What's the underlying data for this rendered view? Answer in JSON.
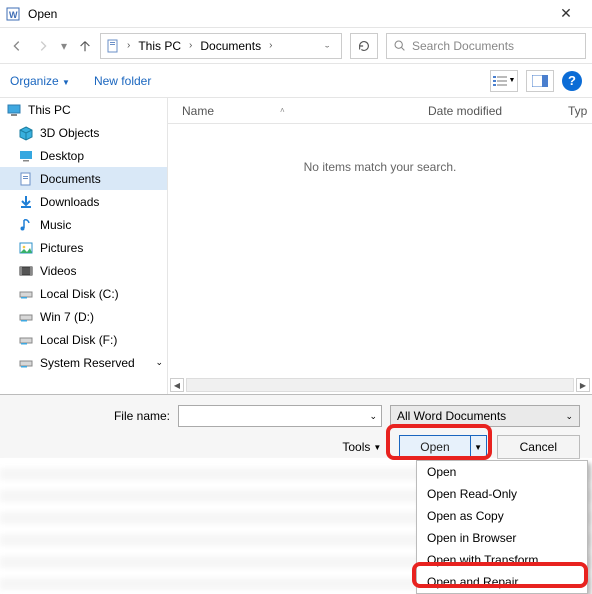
{
  "title": "Open",
  "breadcrumb": {
    "item1": "This PC",
    "item2": "Documents"
  },
  "search": {
    "placeholder": "Search Documents"
  },
  "toolbar": {
    "organize": "Organize",
    "newfolder": "New folder"
  },
  "sidebar": {
    "root": "This PC",
    "items": [
      "3D Objects",
      "Desktop",
      "Documents",
      "Downloads",
      "Music",
      "Pictures",
      "Videos",
      "Local Disk (C:)",
      "Win 7 (D:)",
      "Local Disk (F:)",
      "System Reserved"
    ]
  },
  "columns": {
    "name": "Name",
    "date": "Date modified",
    "type": "Typ"
  },
  "empty": "No items match your search.",
  "filename_label": "File name:",
  "filetype": "All Word Documents",
  "tools": "Tools",
  "open": "Open",
  "cancel": "Cancel",
  "menu": {
    "m1": "Open",
    "m2": "Open Read-Only",
    "m3": "Open as Copy",
    "m4": "Open in Browser",
    "m5": "Open with Transform",
    "m6": "Open and Repair"
  }
}
